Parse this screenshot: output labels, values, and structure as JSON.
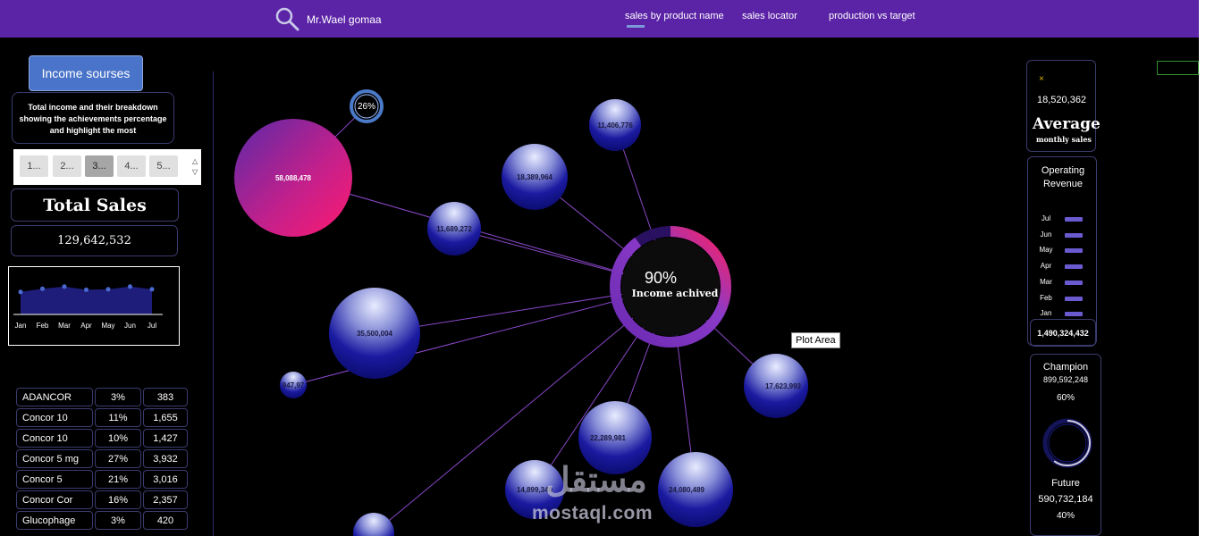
{
  "topbar": {
    "author": "Mr.Wael gomaa",
    "nav": [
      "sales by product name",
      "sales locator",
      "production vs target"
    ]
  },
  "left": {
    "income_button": "Income sourses",
    "description": "Total income and their breakdown showing the achievements percentage and highlight the most",
    "slicer": [
      "1...",
      "2...",
      "3...",
      "4...",
      "5..."
    ],
    "total_title": "Total Sales",
    "total_value": "129,642,532",
    "mini_chart": {
      "months": [
        "Jan",
        "Feb",
        "Mar",
        "Apr",
        "May",
        "Jun",
        "Jul"
      ],
      "values": [
        0.42,
        0.48,
        0.52,
        0.46,
        0.47,
        0.52,
        0.47
      ]
    },
    "products": [
      {
        "name": "ADANCOR",
        "pct": "3%",
        "val": "383"
      },
      {
        "name": "Concor 10",
        "pct": "11%",
        "val": "1,655"
      },
      {
        "name": "Concor 10",
        "pct": "10%",
        "val": "1,427"
      },
      {
        "name": "Concor 5 mg",
        "pct": "27%",
        "val": "3,932"
      },
      {
        "name": "Concor 5",
        "pct": "21%",
        "val": "3,016"
      },
      {
        "name": "Concor Cor",
        "pct": "16%",
        "val": "2,357"
      },
      {
        "name": "Glucophage",
        "pct": "3%",
        "val": "420"
      }
    ]
  },
  "center": {
    "hub_percent": "90%",
    "hub_label": "Income achived",
    "hub_fraction": 0.9,
    "small_ring_label": "26%",
    "plot_area_label": "Plot Area",
    "bubbles": [
      {
        "id": "b1",
        "label": "58,088,478"
      },
      {
        "id": "b2",
        "label": "11,406,776"
      },
      {
        "id": "b3",
        "label": "18,389,964"
      },
      {
        "id": "b4",
        "label": "11,689,272"
      },
      {
        "id": "b5",
        "label": "35,500,004"
      },
      {
        "id": "b6",
        "label": "947,97"
      },
      {
        "id": "b7",
        "label": "17,623,993"
      },
      {
        "id": "b8",
        "label": "22,289,981"
      },
      {
        "id": "b9",
        "label": "14,899,340"
      },
      {
        "id": "b10",
        "label": "24,080,489"
      },
      {
        "id": "b11",
        "label": ""
      }
    ],
    "watermark": "mostaql.com",
    "watermark_ar": "مستقل"
  },
  "right": {
    "avg_x": "×",
    "avg_value": "18,520,362",
    "avg_title": "Average",
    "avg_sub": "monthly sales",
    "op_title": "Operating Revenue",
    "op_months": [
      "Jul",
      "Jun",
      "May",
      "Apr",
      "Mar",
      "Feb",
      "Jan"
    ],
    "op_total": "1,490,324,432",
    "champion_label": "Champion",
    "champion_value": "899,592,248",
    "champion_pct": "60%",
    "future_label": "Future",
    "future_value": "590,732,184",
    "future_pct": "40%",
    "champion_fraction": 0.6
  },
  "colors": {
    "topbar": "#5b23a6",
    "accent_button": "#4a74c9",
    "bubble_blue": "#1a1aa0",
    "bubble_pink": "#e0187a"
  }
}
